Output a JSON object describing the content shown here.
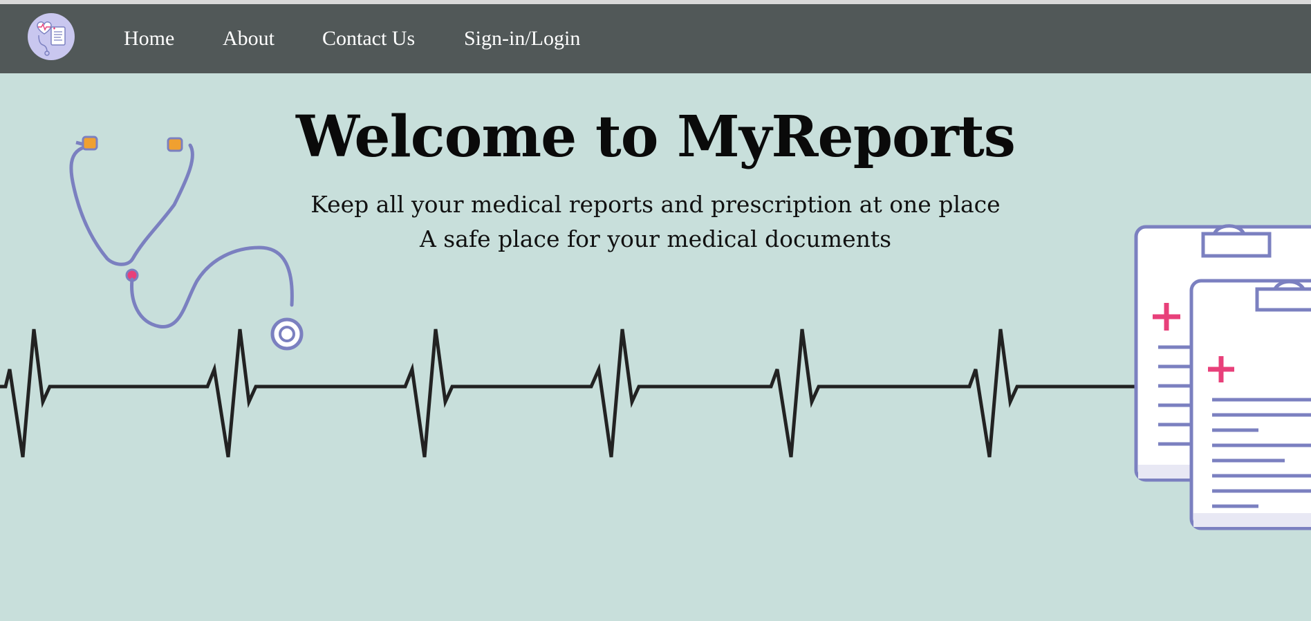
{
  "header": {
    "logo_icon": "medical-records-logo-icon",
    "nav": [
      {
        "label": "Home"
      },
      {
        "label": "About"
      },
      {
        "label": "Contact Us"
      },
      {
        "label": "Sign-in/Login"
      }
    ]
  },
  "hero": {
    "title": "Welcome to MyReports",
    "subtitle_line1": "Keep all your medical reports and prescription at one place",
    "subtitle_line2": "A safe place for your medical documents",
    "illustrations": [
      "stethoscope-icon",
      "heartbeat-line-icon",
      "clipboard-icon"
    ]
  },
  "colors": {
    "navbar": "#515858",
    "hero_background": "#c8dfdb",
    "illustration_stroke": "#7b80c0",
    "accent_pink": "#e8407a",
    "earpiece_orange": "#f0a030",
    "heartbeat": "#222222"
  }
}
